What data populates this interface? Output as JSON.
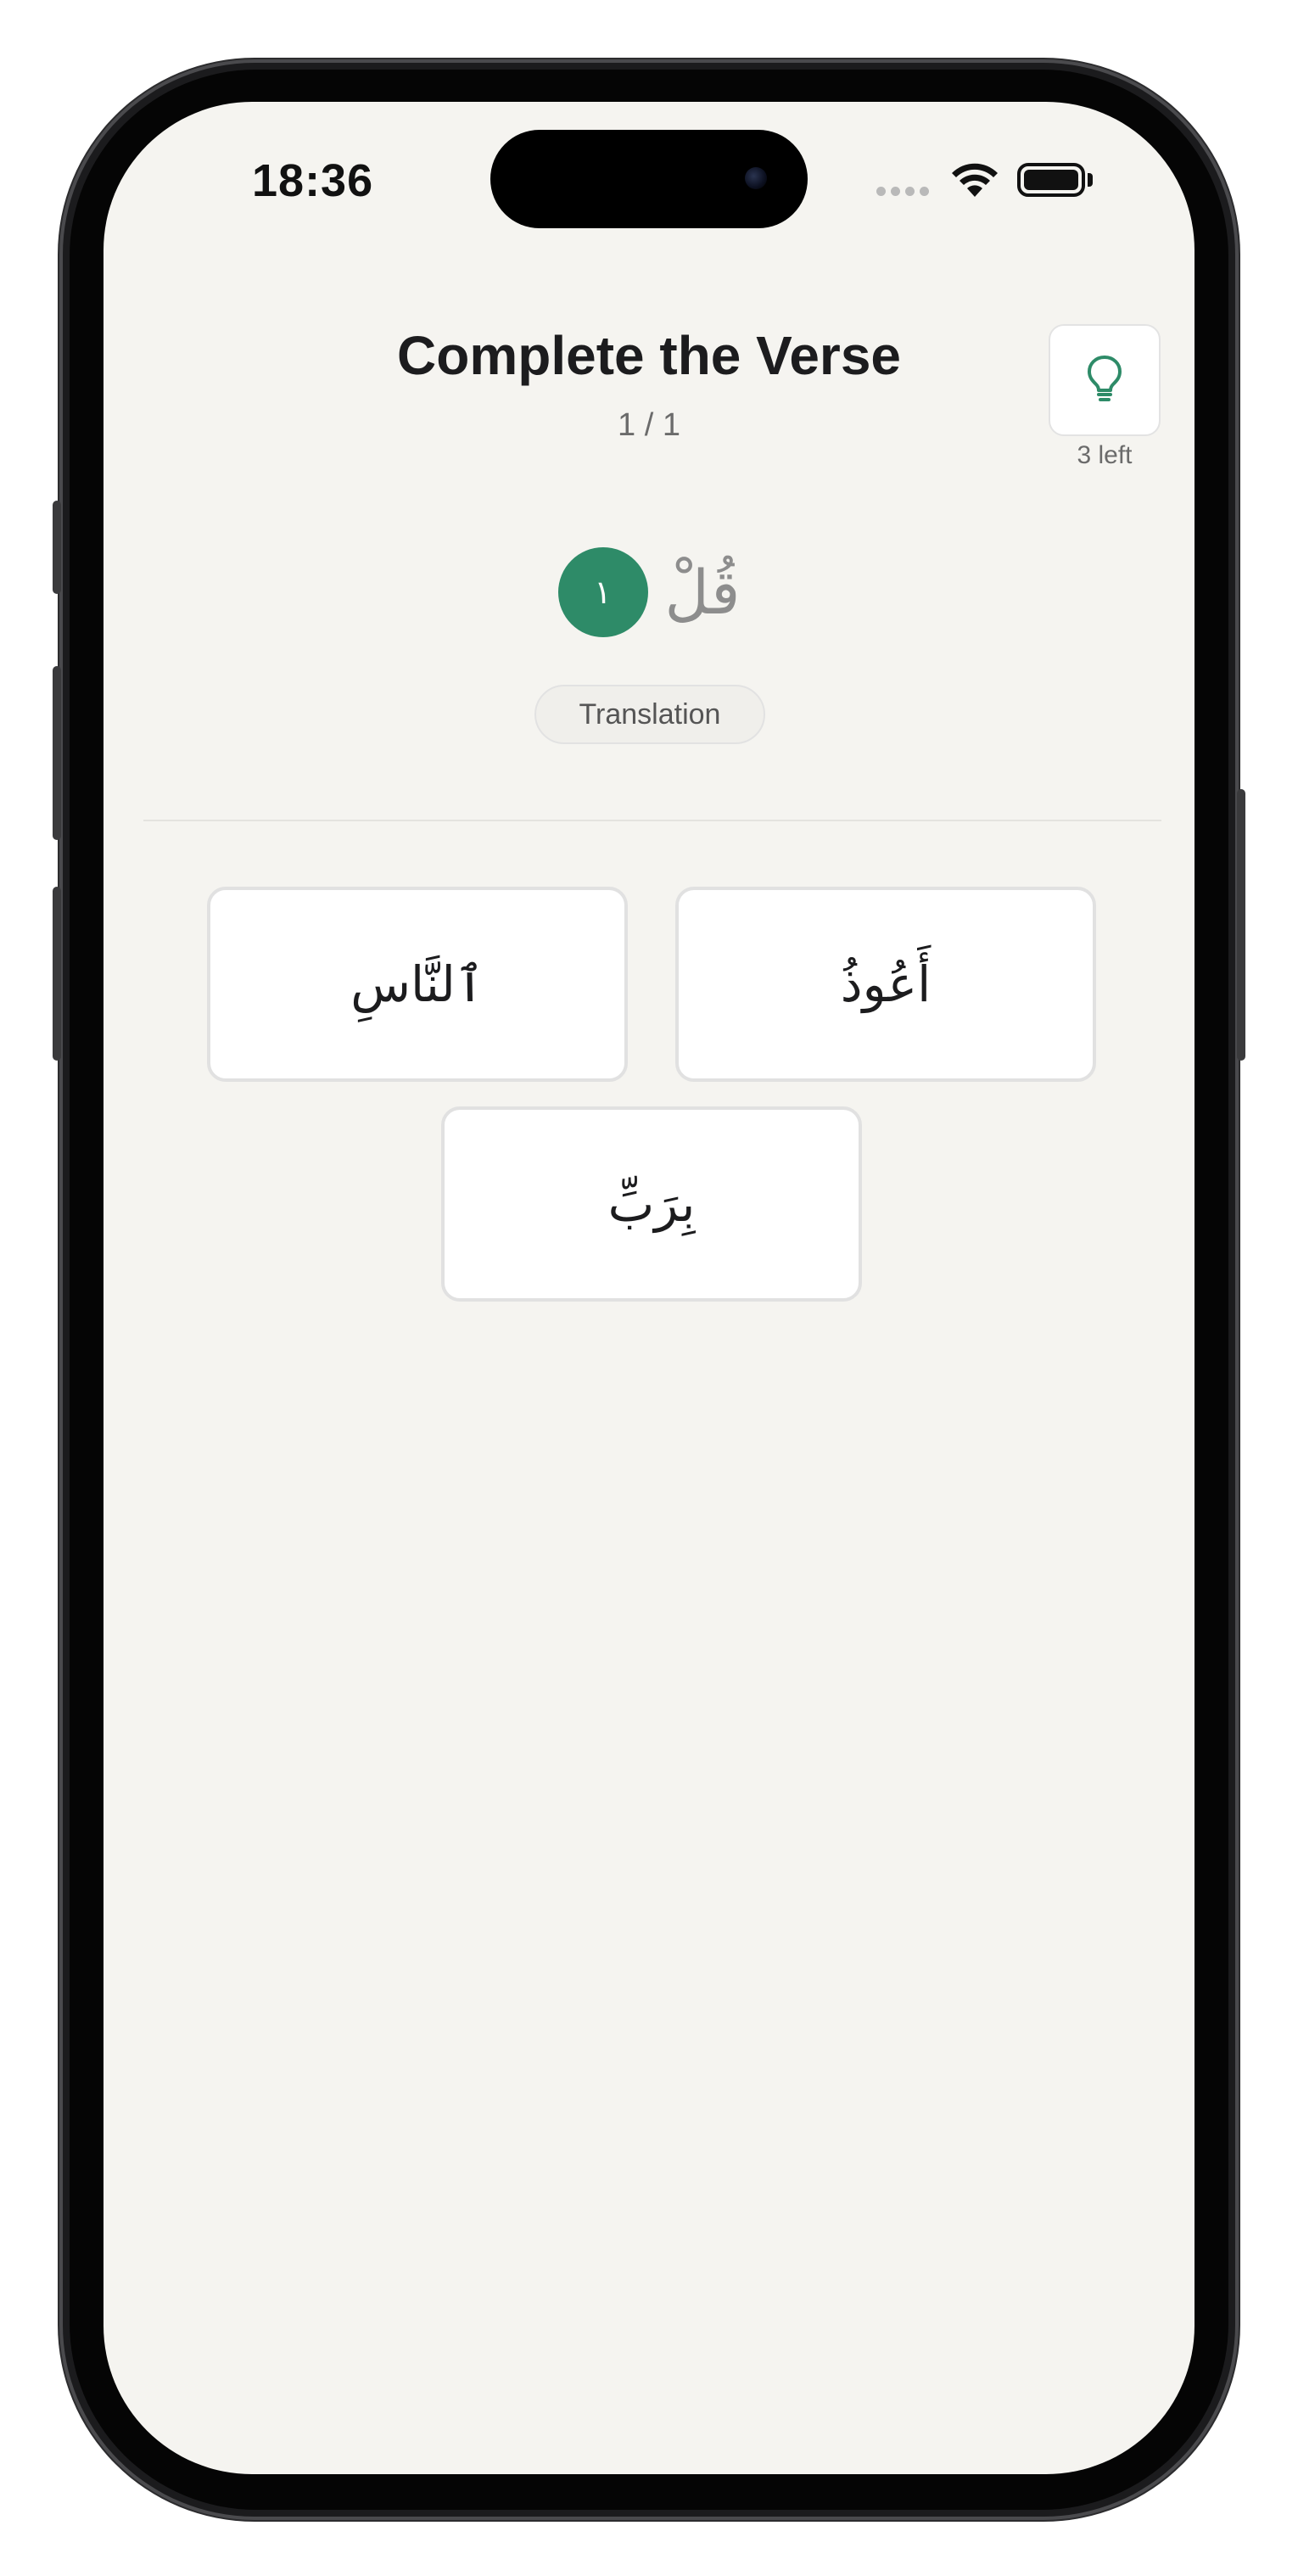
{
  "status_bar": {
    "time": "18:36",
    "icons": [
      "cellular-signal-icon",
      "wifi-icon",
      "battery-icon"
    ]
  },
  "header": {
    "title": "Complete the Verse",
    "progress": "1 / 1"
  },
  "hint": {
    "icon": "lightbulb-icon",
    "remaining_label": "3 left"
  },
  "verse": {
    "number": "١",
    "words": [
      "قُلْ"
    ]
  },
  "translation_button": {
    "label": "Translation"
  },
  "word_choices": [
    {
      "text": "ٱلنَّاسِ"
    },
    {
      "text": "أَعُوذُ"
    },
    {
      "text": "بِرَبِّ"
    }
  ],
  "colors": {
    "accent": "#2e8b68",
    "background": "#f5f4f0",
    "tile": "#ffffff"
  }
}
